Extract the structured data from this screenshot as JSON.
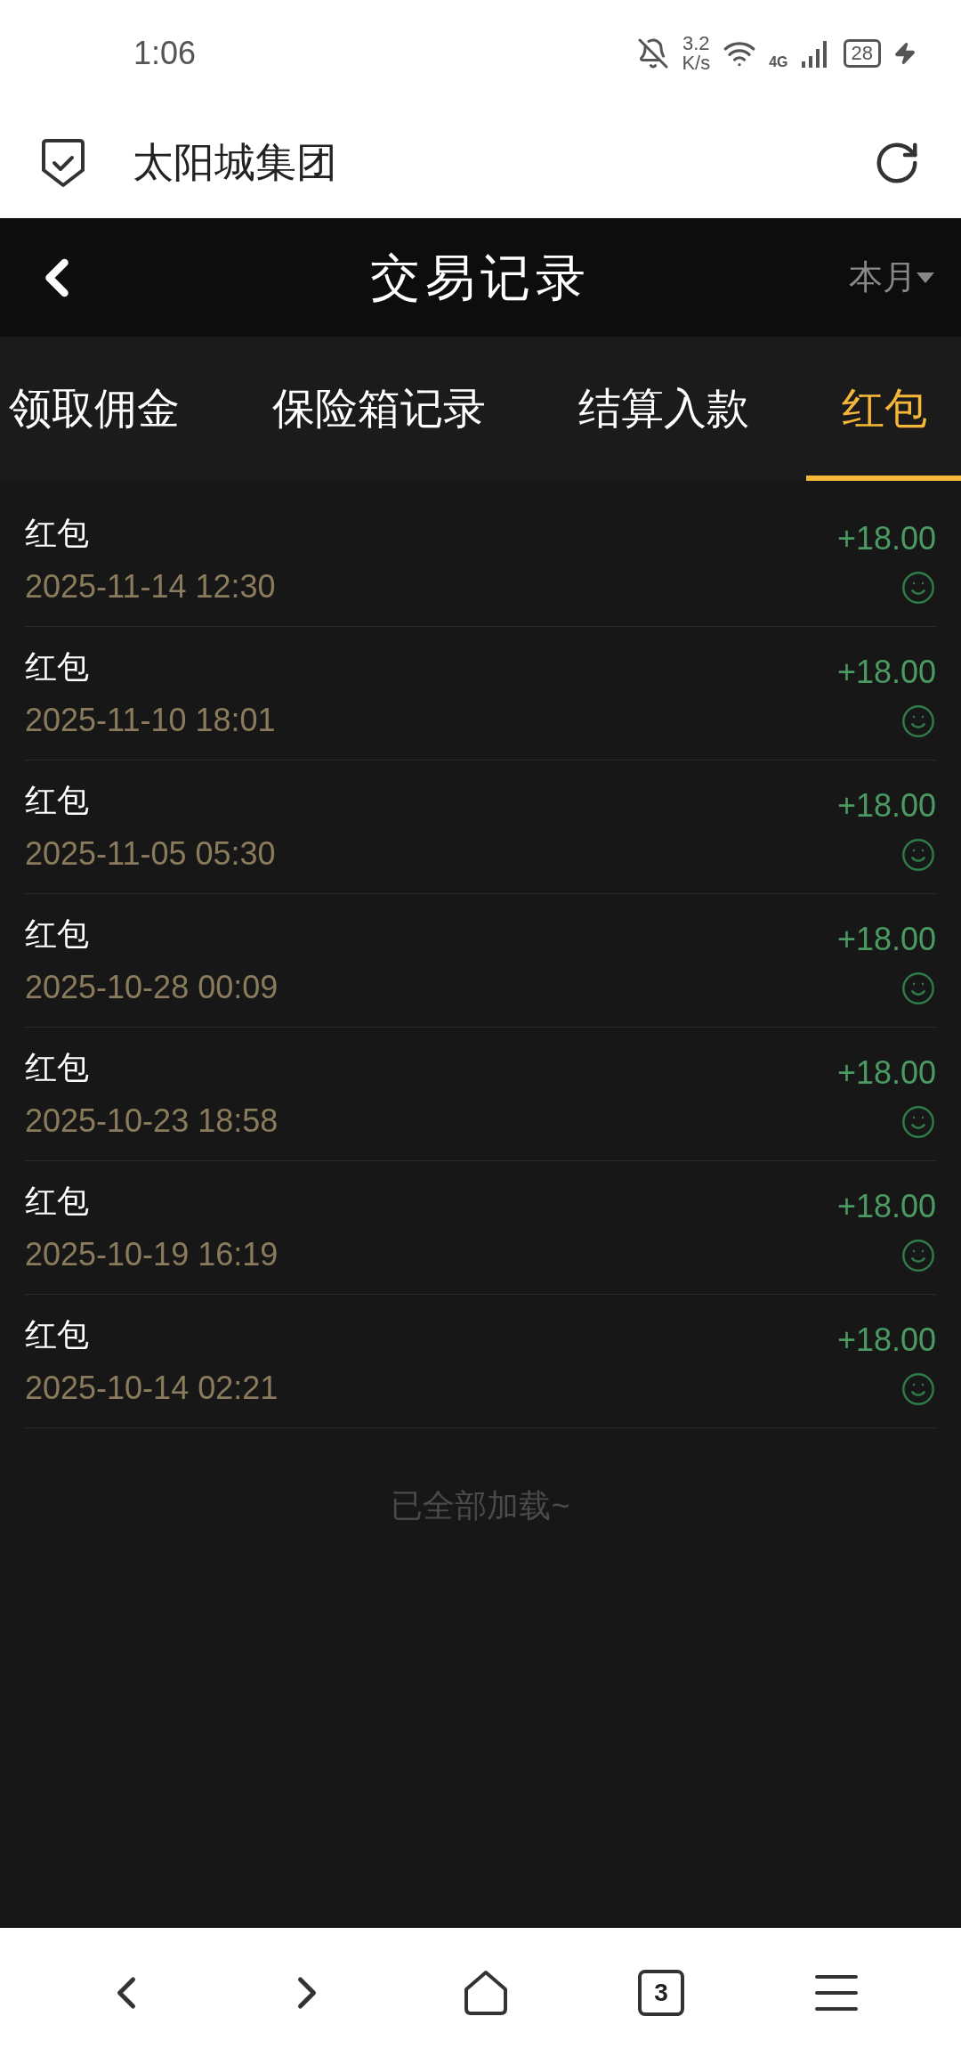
{
  "status_bar": {
    "time": "1:06",
    "speed_value": "3.2",
    "speed_unit": "K/s",
    "network": "4G",
    "battery": "28"
  },
  "address_bar": {
    "title": "太阳城集团"
  },
  "header": {
    "title": "交易记录",
    "filter": "本月"
  },
  "tabs": [
    {
      "label": "领取佣金",
      "selected": false
    },
    {
      "label": "保险箱记录",
      "selected": false
    },
    {
      "label": "结算入款",
      "selected": false
    },
    {
      "label": "红包",
      "selected": true
    }
  ],
  "records": [
    {
      "title": "红包",
      "time": "2025-11-14 12:30",
      "amount": "+18.00"
    },
    {
      "title": "红包",
      "time": "2025-11-10 18:01",
      "amount": "+18.00"
    },
    {
      "title": "红包",
      "time": "2025-11-05 05:30",
      "amount": "+18.00"
    },
    {
      "title": "红包",
      "time": "2025-10-28 00:09",
      "amount": "+18.00"
    },
    {
      "title": "红包",
      "time": "2025-10-23 18:58",
      "amount": "+18.00"
    },
    {
      "title": "红包",
      "time": "2025-10-19 16:19",
      "amount": "+18.00"
    },
    {
      "title": "红包",
      "time": "2025-10-14 02:21",
      "amount": "+18.00"
    }
  ],
  "footer": "已全部加载~",
  "bottom_nav": {
    "tab_count": "3"
  }
}
